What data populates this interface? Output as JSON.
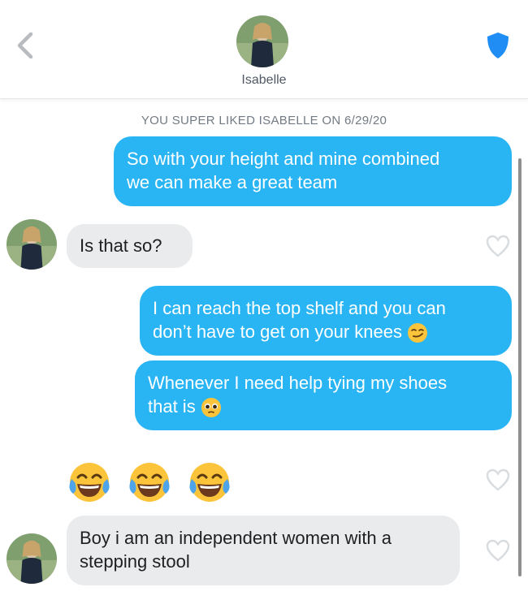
{
  "header": {
    "name": "Isabelle",
    "back_icon": "chevron-left-icon",
    "safety_icon": "shield-icon",
    "accent_color": "#1f8df3"
  },
  "match_note": "YOU SUPER LIKED ISABELLE ON 6/29/20",
  "colors": {
    "outgoing_bubble": "#29b4f3",
    "incoming_bubble": "#e9ebed",
    "heart_outline": "#d9dcdf"
  },
  "messages": [
    {
      "direction": "outgoing",
      "lines": [
        "So with your height and mine combined",
        "we can make a great team"
      ]
    },
    {
      "direction": "incoming",
      "lines": [
        "Is that so?"
      ]
    },
    {
      "direction": "outgoing",
      "lines": [
        "I can reach the top shelf and you can",
        "don’t have to get on your knees"
      ],
      "emoji": "smirking-face-emoji"
    },
    {
      "direction": "outgoing",
      "lines": [
        "Whenever I need help tying my shoes",
        "that is"
      ],
      "emoji": "pleading-face-emoji"
    },
    {
      "direction": "incoming",
      "emoji_only": [
        "joy-emoji",
        "joy-emoji",
        "joy-emoji"
      ]
    },
    {
      "direction": "incoming",
      "lines": [
        "Boy i am an independent women with a",
        "stepping stool"
      ]
    }
  ]
}
